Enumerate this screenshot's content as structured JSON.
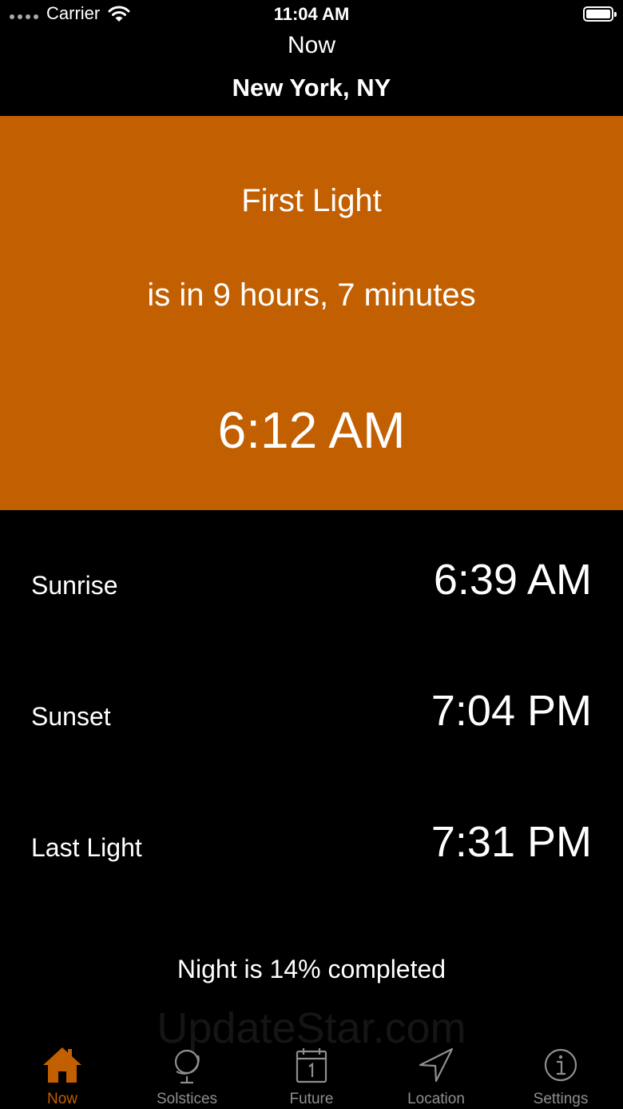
{
  "status_bar": {
    "carrier": "Carrier",
    "time": "11:04 AM",
    "battery_level": 1.0
  },
  "nav": {
    "title": "Now",
    "location": "New York, NY"
  },
  "hero": {
    "event": "First Light",
    "countdown": "is in 9 hours, 7 minutes",
    "time": "6:12 AM",
    "background_color": "#c25f00"
  },
  "events": [
    {
      "label": "Sunrise",
      "time": "6:39 AM"
    },
    {
      "label": "Sunset",
      "time": "7:04 PM"
    },
    {
      "label": "Last Light",
      "time": "7:31 PM"
    }
  ],
  "night_progress": "Night is 14% completed",
  "watermark": "UpdateStar.com",
  "tabs": [
    {
      "label": "Now",
      "icon": "house-icon",
      "active": true
    },
    {
      "label": "Solstices",
      "icon": "globe-icon",
      "active": false
    },
    {
      "label": "Future",
      "icon": "calendar-icon",
      "active": false
    },
    {
      "label": "Location",
      "icon": "location-arrow-icon",
      "active": false
    },
    {
      "label": "Settings",
      "icon": "info-icon",
      "active": false
    }
  ],
  "colors": {
    "accent": "#c25f00",
    "tab_inactive": "#8e8e93"
  }
}
